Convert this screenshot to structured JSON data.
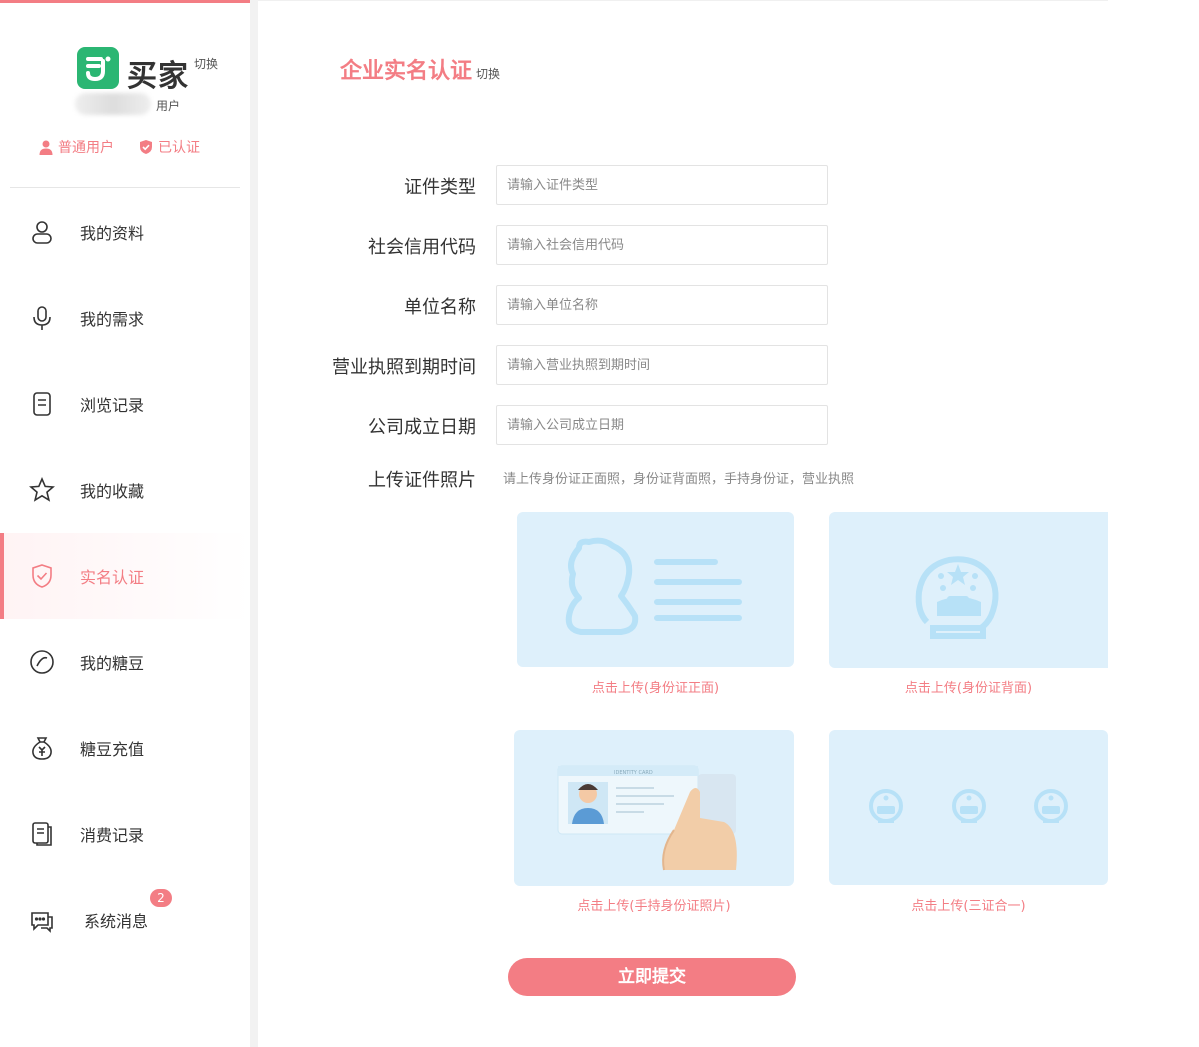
{
  "brand": {
    "name": "买家",
    "switch": "切换",
    "user_role": "用户"
  },
  "status": {
    "normal_user": "普通用户",
    "verified": "已认证"
  },
  "nav": [
    {
      "label": "我的资料",
      "icon": "user-icon"
    },
    {
      "label": "我的需求",
      "icon": "microphone-icon"
    },
    {
      "label": "浏览记录",
      "icon": "document-icon"
    },
    {
      "label": "我的收藏",
      "icon": "star-icon"
    },
    {
      "label": "实名认证",
      "icon": "shield-check-icon",
      "active": true
    },
    {
      "label": "我的糖豆",
      "icon": "bean-icon"
    },
    {
      "label": "糖豆充值",
      "icon": "money-bag-icon"
    },
    {
      "label": "消费记录",
      "icon": "receipt-icon"
    },
    {
      "label": "系统消息",
      "icon": "chat-icon",
      "badge": "2"
    }
  ],
  "page": {
    "title": "企业实名认证",
    "switch": "切换"
  },
  "form": {
    "fields": [
      {
        "label": "证件类型",
        "placeholder": "请输入证件类型",
        "value": ""
      },
      {
        "label": "社会信用代码",
        "placeholder": "请输入社会信用代码",
        "value": ""
      },
      {
        "label": "单位名称",
        "placeholder": "请输入单位名称",
        "value": ""
      },
      {
        "label": "营业执照到期时间",
        "placeholder": "请输入营业执照到期时间",
        "value": ""
      },
      {
        "label": "公司成立日期",
        "placeholder": "请输入公司成立日期",
        "value": ""
      }
    ],
    "upload_label": "上传证件照片",
    "upload_hint": "请上传身份证正面照，身份证背面照，手持身份证，营业执照",
    "uploads": [
      {
        "caption": "点击上传(身份证正面)"
      },
      {
        "caption": "点击上传(身份证背面)"
      },
      {
        "caption": "点击上传(手持身份证照片)"
      },
      {
        "caption": "点击上传(三证合一)"
      }
    ],
    "submit": "立即提交"
  },
  "colors": {
    "accent": "#f37d84",
    "brand_green": "#2bb673",
    "card_bg": "#def0fb",
    "card_icon": "#b7e1f7"
  }
}
